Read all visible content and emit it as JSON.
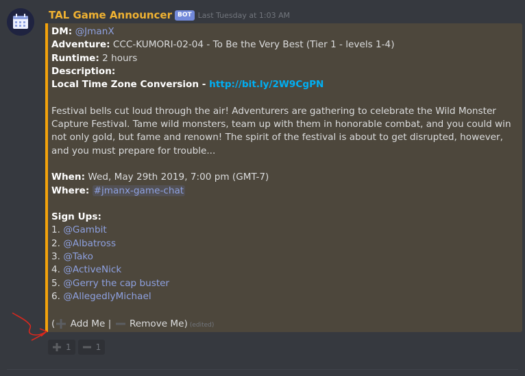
{
  "message": {
    "author": "TAL Game Announcer",
    "bot_tag": "BOT",
    "timestamp": "Last Tuesday at 1:03 AM"
  },
  "colors": {
    "accent": "#f4a30b",
    "embed_bg": "#4d473c",
    "mention": "#8ea1e1",
    "link": "#00aff4",
    "author": "#f0b232"
  },
  "embed": {
    "dm_label": "DM:",
    "dm_value": "@JmanX",
    "adventure_label": "Adventure:",
    "adventure_value": "CCC-KUMORI-02-04 - To Be the Very Best (Tier 1 - levels 1-4)",
    "runtime_label": "Runtime:",
    "runtime_value": "2 hours",
    "description_label": "Description:",
    "timezone_label": "Local Time Zone Conversion - ",
    "timezone_link": "http://bit.ly/2W9CgPN",
    "description": "Festival bells cut loud through the air! Adventurers are gathering to celebrate the Wild Monster Capture Festival. Tame wild monsters, team up with them in honorable combat, and you could win not only gold, but fame and renown! The spirit of the festival is about to get disrupted, however, and you must prepare for trouble...",
    "when_label": "When:",
    "when_value": "Wed, May 29th 2019, 7:00 pm (GMT-7)",
    "where_label": "Where:",
    "where_value": "#jmanx-game-chat",
    "signups_label": "Sign Ups:",
    "signups": [
      {
        "num": "1.",
        "name": "@Gambit"
      },
      {
        "num": "2.",
        "name": "@Albatross"
      },
      {
        "num": "3.",
        "name": "@Tako"
      },
      {
        "num": "4.",
        "name": "@ActiveNick"
      },
      {
        "num": "5.",
        "name": "@Gerry the cap buster"
      },
      {
        "num": "6.",
        "name": "@AllegedlyMichael"
      }
    ],
    "footer_open": "(",
    "add_label": "Add Me",
    "separator": " | ",
    "remove_label": "Remove Me)",
    "edited": "(edited)"
  },
  "reactions": [
    {
      "icon": "plus-icon",
      "count": "1"
    },
    {
      "icon": "minus-icon",
      "count": "1"
    }
  ]
}
